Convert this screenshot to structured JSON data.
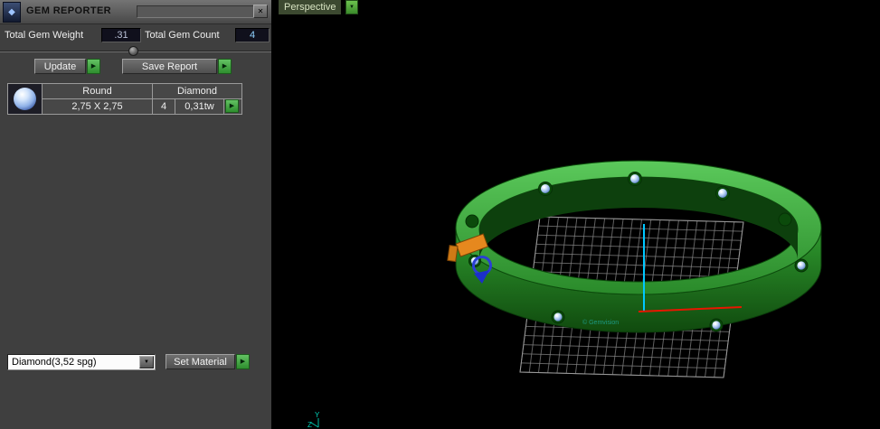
{
  "window": {
    "title": "GEM REPORTER"
  },
  "fields": {
    "weight_label": "Total Gem Weight",
    "weight_value": ".31",
    "count_label": "Total Gem Count",
    "count_value": "4"
  },
  "buttons": {
    "update": "Update",
    "save_report": "Save Report",
    "set_material": "Set Material"
  },
  "gem_table": {
    "shape_header": "Round",
    "material_header": "Diamond",
    "rows": [
      {
        "size": "2,75 X 2,75",
        "count": "4",
        "weight": "0,31tw"
      }
    ]
  },
  "material": {
    "name": "Diamond",
    "density": "(3,52 spg)"
  },
  "viewport": {
    "view_mode": "Perspective",
    "watermark": "© Gemvision",
    "axis_y": "Y",
    "axis_z": "Z"
  },
  "icons": {
    "app": "◆",
    "close": "✕",
    "play": "▶",
    "dropdown": "▼"
  },
  "colors": {
    "accent_green": "#3aa83a",
    "ring_green": "#2f9a2f",
    "gem_blue": "#bcd8f8",
    "axis_cyan": "#00c8ff",
    "axis_red": "#e81600",
    "gizmo_orange": "#e6881e",
    "gizmo_blue": "#2a3fd4"
  }
}
